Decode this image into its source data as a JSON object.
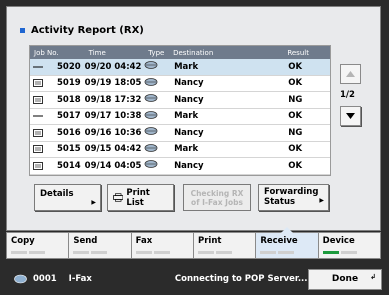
{
  "header": {
    "title": "Activity Report (RX)"
  },
  "table": {
    "columns": [
      "Job No.",
      "Time",
      "Type",
      "Destination",
      "Result"
    ],
    "rows": [
      {
        "job": "5020",
        "time": "09/20 04:42",
        "dest": "Mark",
        "result": "OK"
      },
      {
        "job": "5019",
        "time": "09/19 18:05",
        "dest": "Nancy",
        "result": "OK"
      },
      {
        "job": "5018",
        "time": "09/18 17:32",
        "dest": "Nancy",
        "result": "NG"
      },
      {
        "job": "5017",
        "time": "09/17 10:38",
        "dest": "Mark",
        "result": "OK"
      },
      {
        "job": "5016",
        "time": "09/16 10:36",
        "dest": "Nancy",
        "result": "NG"
      },
      {
        "job": "5015",
        "time": "09/15 04:42",
        "dest": "Mark",
        "result": "OK"
      },
      {
        "job": "5014",
        "time": "09/14 04:05",
        "dest": "Nancy",
        "result": "OK"
      }
    ]
  },
  "pager": {
    "page": "1/2"
  },
  "actions": {
    "details": "Details",
    "print_list": "Print List",
    "checking_rx_1": "Checking RX",
    "checking_rx_2": "of I-Fax Jobs",
    "forwarding_1": "Forwarding",
    "forwarding_2": "Status"
  },
  "tabs": [
    "Copy",
    "Send",
    "Fax",
    "Print",
    "Receive",
    "Device"
  ],
  "status_bar": {
    "count": "0001",
    "label": "I-Fax",
    "message": "Connecting to POP Server...",
    "done": "Done"
  },
  "colors": {
    "selected_row": "#cfe2f0",
    "header_bg": "#6f7b8c",
    "indicator_green": "#1d9a3d",
    "accent_blue": "#1f66d1"
  }
}
